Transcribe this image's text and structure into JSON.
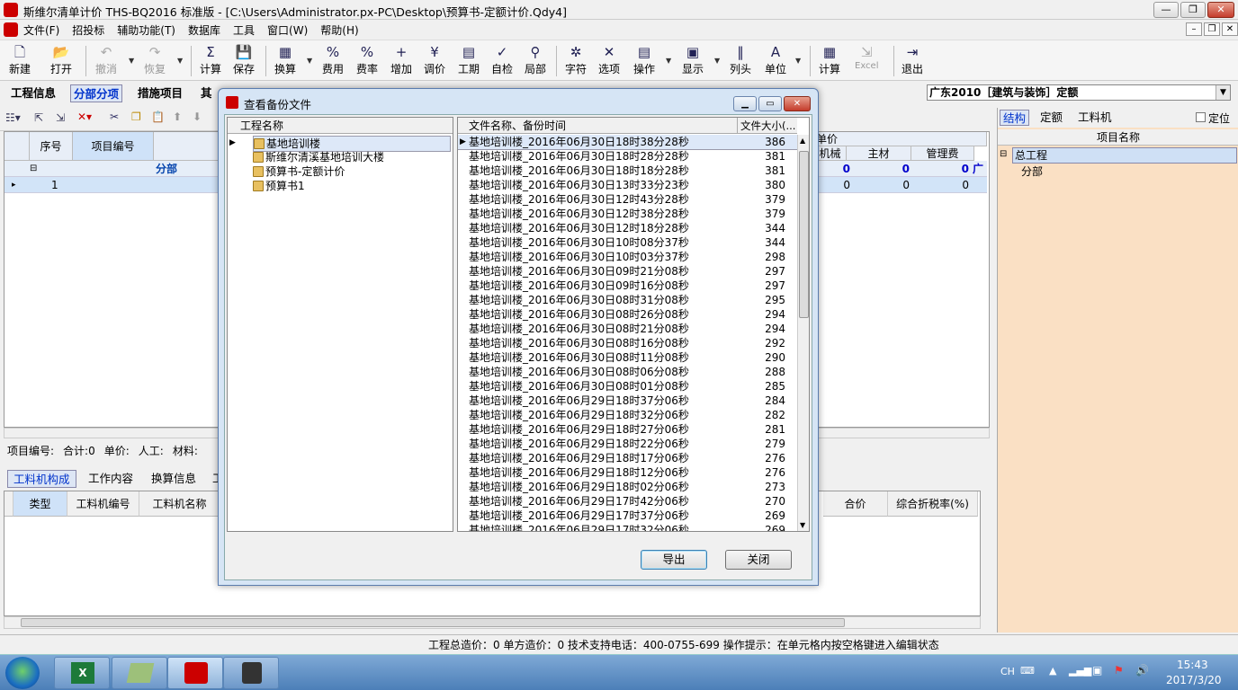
{
  "window": {
    "title": "斯维尔清单计价 THS-BQ2016 标准版 - [C:\\Users\\Administrator.px-PC\\Desktop\\预算书-定额计价.Qdy4]",
    "min_label": "—",
    "restore_label": "❐",
    "close_label": "✕"
  },
  "menu": {
    "items": [
      "文件(F)",
      "招投标",
      "辅助功能(T)",
      "数据库",
      "工具",
      "窗口(W)",
      "帮助(H)"
    ],
    "mdi_min": "–",
    "mdi_restore": "❐",
    "mdi_close": "✕"
  },
  "toolbar": {
    "items": [
      {
        "label": "新建",
        "icon": "🗋"
      },
      {
        "label": "打开",
        "icon": "📂"
      },
      {
        "label": "撤消",
        "icon": "↶"
      },
      {
        "label": "恢复",
        "icon": "↷"
      },
      {
        "label": "计算",
        "icon": "Σ"
      },
      {
        "label": "保存",
        "icon": "💾"
      },
      {
        "label": "换算",
        "icon": "▦"
      },
      {
        "label": "费用",
        "icon": "%"
      },
      {
        "label": "费率",
        "icon": "%"
      },
      {
        "label": "增加",
        "icon": "+"
      },
      {
        "label": "调价",
        "icon": "¥"
      },
      {
        "label": "工期",
        "icon": "▤"
      },
      {
        "label": "自检",
        "icon": "✓"
      },
      {
        "label": "局部",
        "icon": "⚲"
      },
      {
        "label": "字符",
        "icon": "✲"
      },
      {
        "label": "选项",
        "icon": "✕"
      },
      {
        "label": "操作",
        "icon": "▤"
      },
      {
        "label": "显示",
        "icon": "▣"
      },
      {
        "label": "列头",
        "icon": "‖"
      },
      {
        "label": "单位",
        "icon": "A"
      },
      {
        "label": "计算",
        "icon": "▦"
      },
      {
        "label": "Excel",
        "icon": "⇲"
      },
      {
        "label": "退出",
        "icon": "⇥"
      }
    ]
  },
  "tabs": [
    "工程信息",
    "分部分项",
    "措施项目",
    "其他"
  ],
  "db_select": "广东2010［建筑与装饰］定额",
  "grid": {
    "headers": [
      "序号",
      "项目编号"
    ],
    "right_headers": [
      "单价",
      "机械",
      "主材",
      "管理费"
    ],
    "row_group_label": "分部",
    "row_values": [
      "0",
      "0",
      "0",
      "广"
    ],
    "row_values2": [
      "0",
      "0",
      "0"
    ],
    "row1_num": "1"
  },
  "info_row": [
    "项目编号:",
    "合计:0",
    "单价:",
    "人工:",
    "材料:"
  ],
  "bottom_tabs": [
    "工料机构成",
    "工作内容",
    "换算信息",
    "工"
  ],
  "bottom_grid_headers": [
    "类型",
    "工料机编号",
    "工料机名称",
    "合价",
    "综合折税率(%)"
  ],
  "right_panel": {
    "tabs": [
      "结构",
      "定额",
      "工料机"
    ],
    "locate_label": "定位",
    "header": "项目名称",
    "tree": [
      "总工程",
      "分部"
    ]
  },
  "status_bar": "工程总造价：0   单方造价：0   技术支持电话：400-0755-699   操作提示：在单元格内按空格键进入编辑状态",
  "taskbar": {
    "lang": "CH",
    "time": "15:43",
    "date": "2017/3/20"
  },
  "dialog": {
    "title": "查看备份文件",
    "left_header": "工程名称",
    "projects": [
      "基地培训楼",
      "斯维尔清溪基地培训大楼",
      "预算书-定额计价",
      "预算书1"
    ],
    "right_header_name": "文件名称、备份时间",
    "right_header_size": "文件大小(...",
    "files": [
      {
        "name": "基地培训楼_2016年06月30日18时38分28秒",
        "size": "386"
      },
      {
        "name": "基地培训楼_2016年06月30日18时28分28秒",
        "size": "381"
      },
      {
        "name": "基地培训楼_2016年06月30日18时18分28秒",
        "size": "381"
      },
      {
        "name": "基地培训楼_2016年06月30日13时33分23秒",
        "size": "380"
      },
      {
        "name": "基地培训楼_2016年06月30日12时43分28秒",
        "size": "379"
      },
      {
        "name": "基地培训楼_2016年06月30日12时38分28秒",
        "size": "379"
      },
      {
        "name": "基地培训楼_2016年06月30日12时18分28秒",
        "size": "344"
      },
      {
        "name": "基地培训楼_2016年06月30日10时08分37秒",
        "size": "344"
      },
      {
        "name": "基地培训楼_2016年06月30日10时03分37秒",
        "size": "298"
      },
      {
        "name": "基地培训楼_2016年06月30日09时21分08秒",
        "size": "297"
      },
      {
        "name": "基地培训楼_2016年06月30日09时16分08秒",
        "size": "297"
      },
      {
        "name": "基地培训楼_2016年06月30日08时31分08秒",
        "size": "295"
      },
      {
        "name": "基地培训楼_2016年06月30日08时26分08秒",
        "size": "294"
      },
      {
        "name": "基地培训楼_2016年06月30日08时21分08秒",
        "size": "294"
      },
      {
        "name": "基地培训楼_2016年06月30日08时16分08秒",
        "size": "292"
      },
      {
        "name": "基地培训楼_2016年06月30日08时11分08秒",
        "size": "290"
      },
      {
        "name": "基地培训楼_2016年06月30日08时06分08秒",
        "size": "288"
      },
      {
        "name": "基地培训楼_2016年06月30日08时01分08秒",
        "size": "285"
      },
      {
        "name": "基地培训楼_2016年06月29日18时37分06秒",
        "size": "284"
      },
      {
        "name": "基地培训楼_2016年06月29日18时32分06秒",
        "size": "282"
      },
      {
        "name": "基地培训楼_2016年06月29日18时27分06秒",
        "size": "281"
      },
      {
        "name": "基地培训楼_2016年06月29日18时22分06秒",
        "size": "279"
      },
      {
        "name": "基地培训楼_2016年06月29日18时17分06秒",
        "size": "276"
      },
      {
        "name": "基地培训楼_2016年06月29日18时12分06秒",
        "size": "276"
      },
      {
        "name": "基地培训楼_2016年06月29日18时02分06秒",
        "size": "273"
      },
      {
        "name": "基地培训楼_2016年06月29日17时42分06秒",
        "size": "270"
      },
      {
        "name": "基地培训楼_2016年06月29日17时37分06秒",
        "size": "269"
      },
      {
        "name": "基地培训楼_2016年06月29日17时32分06秒",
        "size": "269"
      }
    ],
    "export_label": "导出",
    "close_label": "关闭"
  }
}
